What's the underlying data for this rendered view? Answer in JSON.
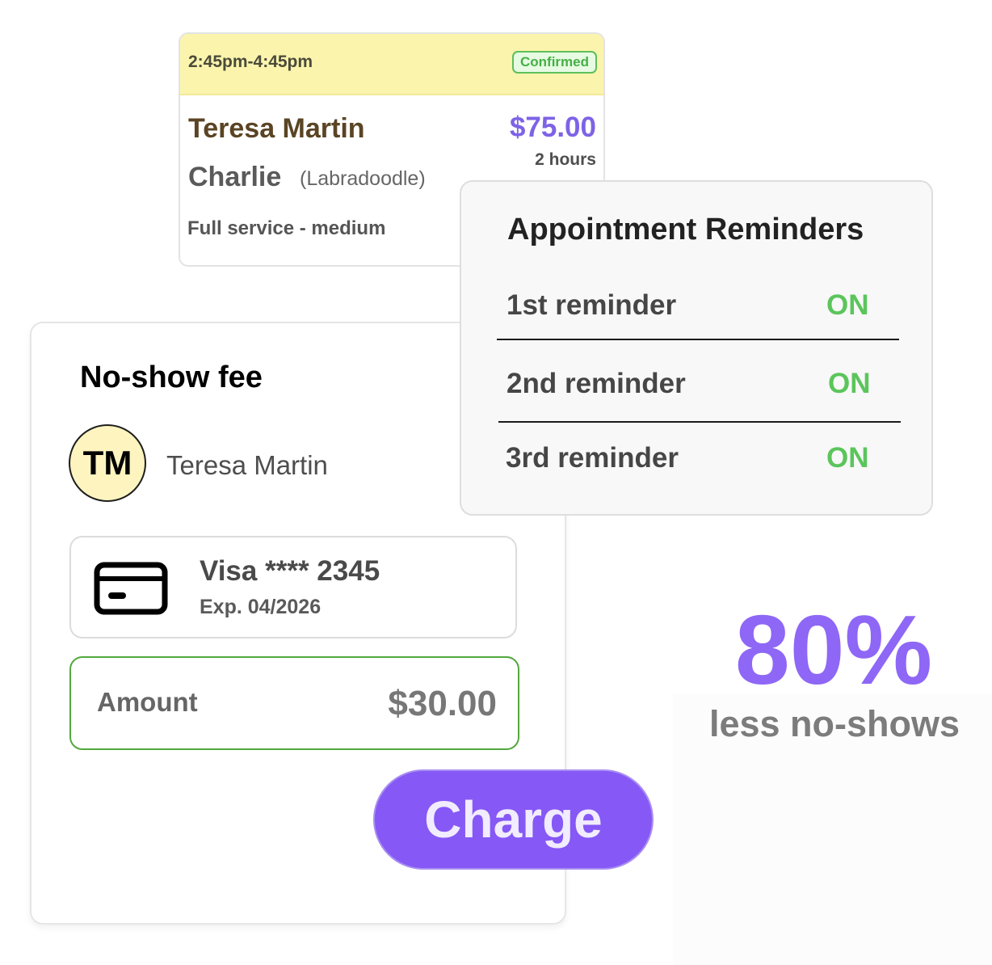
{
  "appointment": {
    "time_range": "2:45pm-4:45pm",
    "status": "Confirmed",
    "client_name": "Teresa Martin",
    "price": "$75.00",
    "duration": "2 hours",
    "pet_name": "Charlie",
    "pet_breed": "(Labradoodle)",
    "service": "Full service - medium",
    "colors": {
      "header": "#fbf4ad",
      "status": "#45b045",
      "price": "#7e63e6"
    }
  },
  "reminders": {
    "title": "Appointment Reminders",
    "items": [
      {
        "label": "1st reminder",
        "status": "ON"
      },
      {
        "label": "2nd reminder",
        "status": "ON"
      },
      {
        "label": "3rd reminder",
        "status": "ON"
      }
    ],
    "status_color": "#5bc55b"
  },
  "no_show": {
    "title": "No-show fee",
    "avatar_initials": "TM",
    "client_name": "Teresa Martin",
    "card": {
      "icon": "credit-card-icon",
      "number": "Visa **** 2345",
      "expiry": "Exp. 04/2026"
    },
    "amount_label": "Amount",
    "amount_value": "$30.00",
    "charge_label": "Charge",
    "accent_color": "#8658f5"
  },
  "stat": {
    "value": "80%",
    "caption": "less no-shows"
  }
}
